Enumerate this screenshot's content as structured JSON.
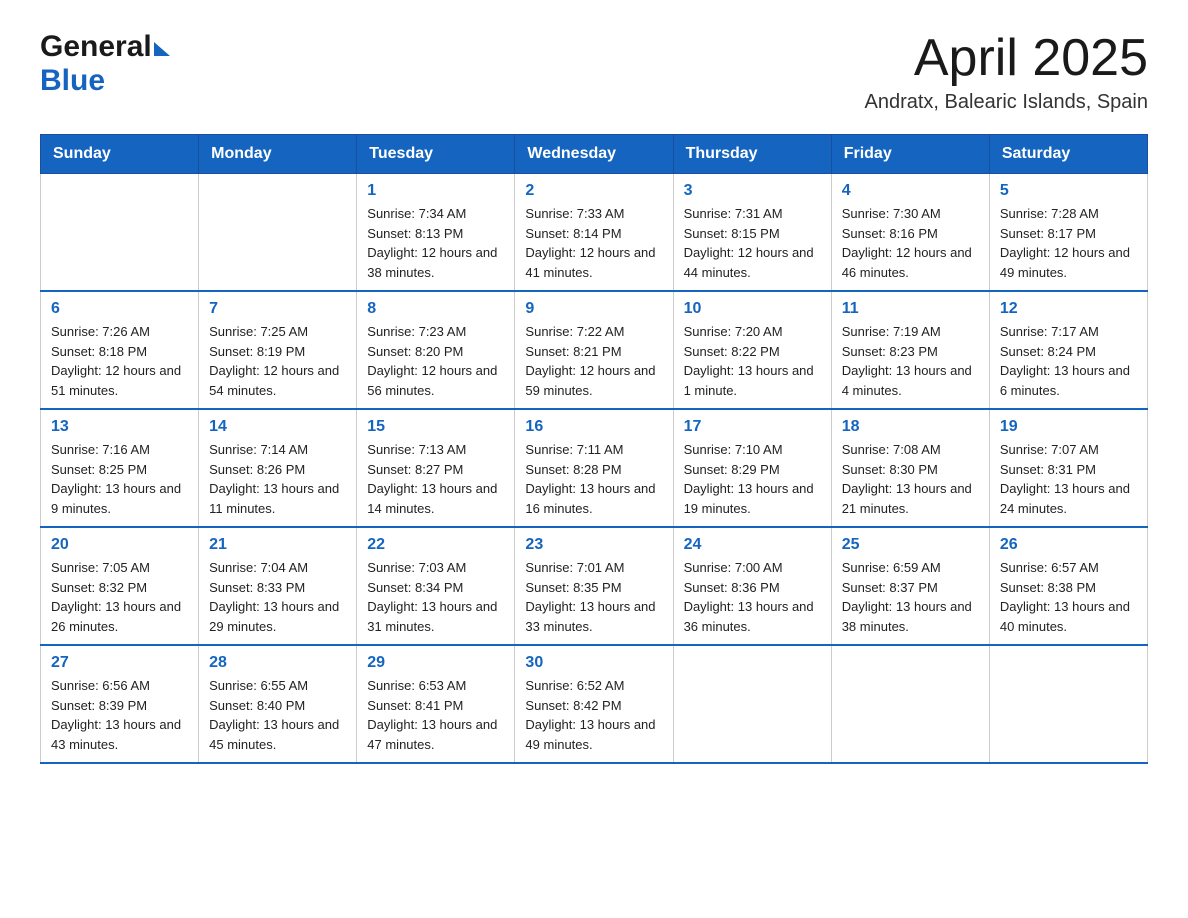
{
  "header": {
    "logo": {
      "general": "General",
      "blue": "Blue"
    },
    "title": "April 2025",
    "location": "Andratx, Balearic Islands, Spain"
  },
  "days_of_week": [
    "Sunday",
    "Monday",
    "Tuesday",
    "Wednesday",
    "Thursday",
    "Friday",
    "Saturday"
  ],
  "weeks": [
    [
      {
        "day": "",
        "sunrise": "",
        "sunset": "",
        "daylight": ""
      },
      {
        "day": "",
        "sunrise": "",
        "sunset": "",
        "daylight": ""
      },
      {
        "day": "1",
        "sunrise": "7:34 AM",
        "sunset": "8:13 PM",
        "daylight": "12 hours and 38 minutes."
      },
      {
        "day": "2",
        "sunrise": "7:33 AM",
        "sunset": "8:14 PM",
        "daylight": "12 hours and 41 minutes."
      },
      {
        "day": "3",
        "sunrise": "7:31 AM",
        "sunset": "8:15 PM",
        "daylight": "12 hours and 44 minutes."
      },
      {
        "day": "4",
        "sunrise": "7:30 AM",
        "sunset": "8:16 PM",
        "daylight": "12 hours and 46 minutes."
      },
      {
        "day": "5",
        "sunrise": "7:28 AM",
        "sunset": "8:17 PM",
        "daylight": "12 hours and 49 minutes."
      }
    ],
    [
      {
        "day": "6",
        "sunrise": "7:26 AM",
        "sunset": "8:18 PM",
        "daylight": "12 hours and 51 minutes."
      },
      {
        "day": "7",
        "sunrise": "7:25 AM",
        "sunset": "8:19 PM",
        "daylight": "12 hours and 54 minutes."
      },
      {
        "day": "8",
        "sunrise": "7:23 AM",
        "sunset": "8:20 PM",
        "daylight": "12 hours and 56 minutes."
      },
      {
        "day": "9",
        "sunrise": "7:22 AM",
        "sunset": "8:21 PM",
        "daylight": "12 hours and 59 minutes."
      },
      {
        "day": "10",
        "sunrise": "7:20 AM",
        "sunset": "8:22 PM",
        "daylight": "13 hours and 1 minute."
      },
      {
        "day": "11",
        "sunrise": "7:19 AM",
        "sunset": "8:23 PM",
        "daylight": "13 hours and 4 minutes."
      },
      {
        "day": "12",
        "sunrise": "7:17 AM",
        "sunset": "8:24 PM",
        "daylight": "13 hours and 6 minutes."
      }
    ],
    [
      {
        "day": "13",
        "sunrise": "7:16 AM",
        "sunset": "8:25 PM",
        "daylight": "13 hours and 9 minutes."
      },
      {
        "day": "14",
        "sunrise": "7:14 AM",
        "sunset": "8:26 PM",
        "daylight": "13 hours and 11 minutes."
      },
      {
        "day": "15",
        "sunrise": "7:13 AM",
        "sunset": "8:27 PM",
        "daylight": "13 hours and 14 minutes."
      },
      {
        "day": "16",
        "sunrise": "7:11 AM",
        "sunset": "8:28 PM",
        "daylight": "13 hours and 16 minutes."
      },
      {
        "day": "17",
        "sunrise": "7:10 AM",
        "sunset": "8:29 PM",
        "daylight": "13 hours and 19 minutes."
      },
      {
        "day": "18",
        "sunrise": "7:08 AM",
        "sunset": "8:30 PM",
        "daylight": "13 hours and 21 minutes."
      },
      {
        "day": "19",
        "sunrise": "7:07 AM",
        "sunset": "8:31 PM",
        "daylight": "13 hours and 24 minutes."
      }
    ],
    [
      {
        "day": "20",
        "sunrise": "7:05 AM",
        "sunset": "8:32 PM",
        "daylight": "13 hours and 26 minutes."
      },
      {
        "day": "21",
        "sunrise": "7:04 AM",
        "sunset": "8:33 PM",
        "daylight": "13 hours and 29 minutes."
      },
      {
        "day": "22",
        "sunrise": "7:03 AM",
        "sunset": "8:34 PM",
        "daylight": "13 hours and 31 minutes."
      },
      {
        "day": "23",
        "sunrise": "7:01 AM",
        "sunset": "8:35 PM",
        "daylight": "13 hours and 33 minutes."
      },
      {
        "day": "24",
        "sunrise": "7:00 AM",
        "sunset": "8:36 PM",
        "daylight": "13 hours and 36 minutes."
      },
      {
        "day": "25",
        "sunrise": "6:59 AM",
        "sunset": "8:37 PM",
        "daylight": "13 hours and 38 minutes."
      },
      {
        "day": "26",
        "sunrise": "6:57 AM",
        "sunset": "8:38 PM",
        "daylight": "13 hours and 40 minutes."
      }
    ],
    [
      {
        "day": "27",
        "sunrise": "6:56 AM",
        "sunset": "8:39 PM",
        "daylight": "13 hours and 43 minutes."
      },
      {
        "day": "28",
        "sunrise": "6:55 AM",
        "sunset": "8:40 PM",
        "daylight": "13 hours and 45 minutes."
      },
      {
        "day": "29",
        "sunrise": "6:53 AM",
        "sunset": "8:41 PM",
        "daylight": "13 hours and 47 minutes."
      },
      {
        "day": "30",
        "sunrise": "6:52 AM",
        "sunset": "8:42 PM",
        "daylight": "13 hours and 49 minutes."
      },
      {
        "day": "",
        "sunrise": "",
        "sunset": "",
        "daylight": ""
      },
      {
        "day": "",
        "sunrise": "",
        "sunset": "",
        "daylight": ""
      },
      {
        "day": "",
        "sunrise": "",
        "sunset": "",
        "daylight": ""
      }
    ]
  ],
  "labels": {
    "sunrise": "Sunrise:",
    "sunset": "Sunset:",
    "daylight": "Daylight:"
  }
}
